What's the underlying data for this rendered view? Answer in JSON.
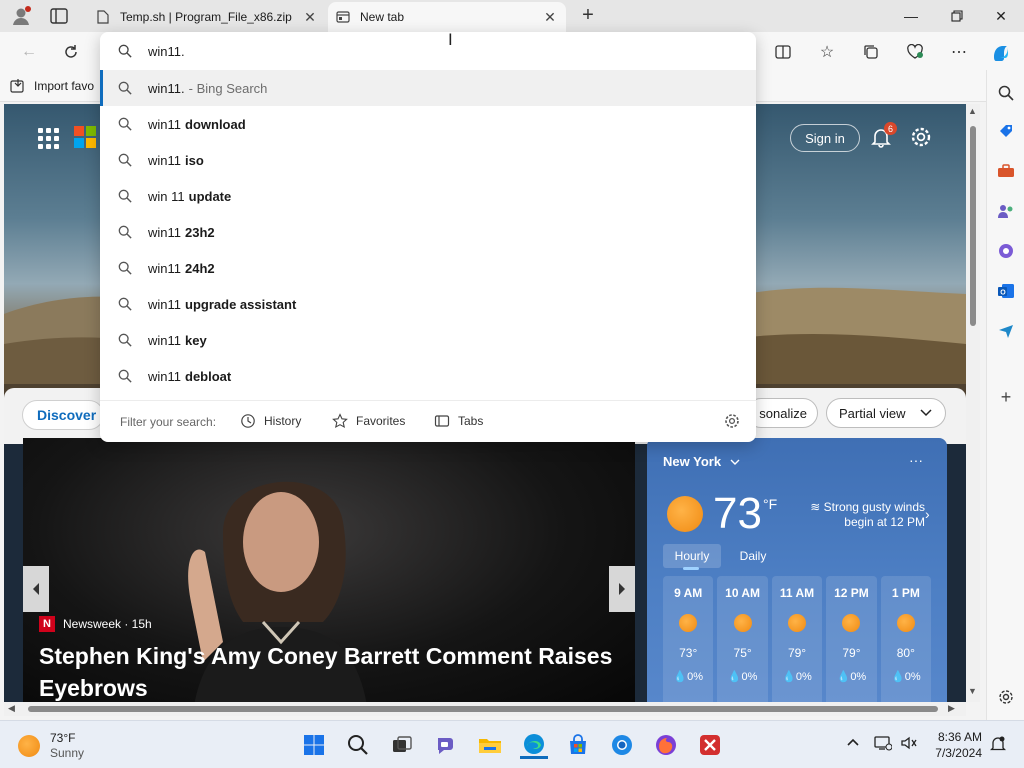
{
  "browser": {
    "tabs": [
      {
        "label": "Temp.sh | Program_File_x86.zip",
        "favicon": "page-icon"
      },
      {
        "label": "New tab",
        "favicon": "newtab-icon"
      }
    ],
    "favorites_bar": {
      "import_label": "Import favo"
    }
  },
  "omnibox": {
    "value": "win11.",
    "suggestions": [
      {
        "prefix": "win11.",
        "suffix": "",
        "hint": "- Bing Search"
      },
      {
        "prefix": "win11",
        "suffix": "download",
        "hint": ""
      },
      {
        "prefix": "win11",
        "suffix": "iso",
        "hint": ""
      },
      {
        "prefix": "win 11",
        "suffix": "update",
        "hint": ""
      },
      {
        "prefix": "win11",
        "suffix": "23h2",
        "hint": ""
      },
      {
        "prefix": "win11",
        "suffix": "24h2",
        "hint": ""
      },
      {
        "prefix": "win11",
        "suffix": "upgrade assistant",
        "hint": ""
      },
      {
        "prefix": "win11",
        "suffix": "key",
        "hint": ""
      },
      {
        "prefix": "win11",
        "suffix": "debloat",
        "hint": ""
      }
    ],
    "filter": {
      "label": "Filter your search:",
      "history": "History",
      "favorites": "Favorites",
      "tabs": "Tabs"
    }
  },
  "newtab": {
    "sign_in": "Sign in",
    "notification_count": "6",
    "discover": "Discover",
    "personalize": "sonalize",
    "view": "Partial view",
    "news": {
      "source": "Newsweek · 15h",
      "headline": "Stephen King's Amy Coney Barrett Comment Raises Eyebrows"
    },
    "weather": {
      "city": "New York",
      "temp": "73",
      "unit": "°F",
      "alert": "Strong gusty winds begin at 12 PM",
      "tab_hourly": "Hourly",
      "tab_daily": "Daily",
      "hours": [
        {
          "time": "9 AM",
          "temp": "73°",
          "precip": "0%"
        },
        {
          "time": "10 AM",
          "temp": "75°",
          "precip": "0%"
        },
        {
          "time": "11 AM",
          "temp": "79°",
          "precip": "0%"
        },
        {
          "time": "12 PM",
          "temp": "79°",
          "precip": "0%"
        },
        {
          "time": "1 PM",
          "temp": "80°",
          "precip": "0%"
        }
      ]
    }
  },
  "taskbar": {
    "weather_temp": "73°F",
    "weather_desc": "Sunny",
    "time": "8:36 AM",
    "date": "7/3/2024"
  },
  "colors": {
    "accent": "#0f6cbd",
    "weather_bg": "#4d7fc4",
    "news_logo": "#d0021b"
  }
}
